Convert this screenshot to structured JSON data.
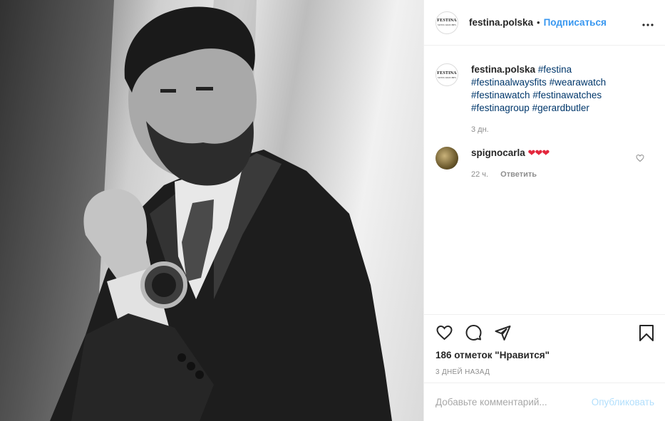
{
  "account": {
    "username": "festina.polska",
    "separator": "•",
    "follow_label": "Подписаться",
    "logo_text": "FESTINA",
    "logo_subtext": "SWISS WATCHES"
  },
  "caption": {
    "username": "festina.polska",
    "hashtags": [
      "#festina",
      "#festinaalwaysfits",
      "#wearawatch",
      "#festinawatch",
      "#festinawatches",
      "#festinagroup",
      "#gerardbutler"
    ],
    "time": "3 дн."
  },
  "comment": {
    "username": "spignocarla",
    "text": "❤❤❤",
    "time": "22 ч.",
    "reply_label": "Ответить"
  },
  "actions": {
    "likes": "186 отметок \"Нравится\"",
    "posted": "3 ДНЕЙ НАЗАД"
  },
  "add_comment": {
    "placeholder": "Добавьте комментарий...",
    "publish_label": "Опубликовать"
  },
  "icons": {
    "more": "more-icon",
    "like": "heart-icon",
    "comment": "comment-icon",
    "share": "share-icon",
    "save": "bookmark-icon",
    "comment_like": "heart-icon"
  },
  "colors": {
    "accent": "#3897f0",
    "hashtag": "#00376b",
    "muted": "#8e8e8e",
    "heart": "#e3263c"
  }
}
